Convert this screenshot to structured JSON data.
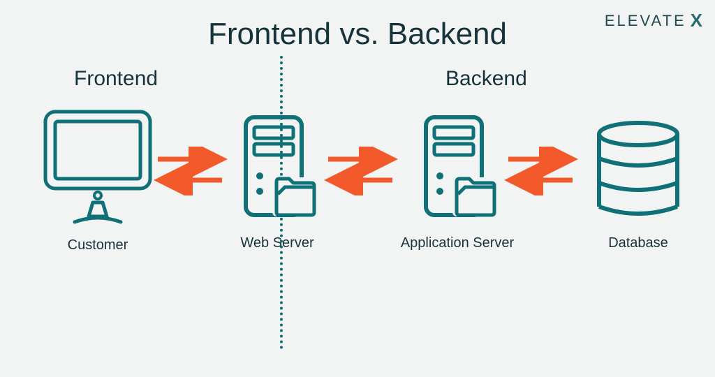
{
  "title": "Frontend vs. Backend",
  "sections": {
    "frontend": "Frontend",
    "backend": "Backend"
  },
  "nodes": {
    "customer": "Customer",
    "web_server": "Web Server",
    "app_server": "Application Server",
    "database": "Database"
  },
  "logo": {
    "text": "ELEVATE",
    "mark": "X"
  },
  "colors": {
    "teal": "#0f7077",
    "orange": "#f35a2b",
    "ink": "#16323a"
  }
}
